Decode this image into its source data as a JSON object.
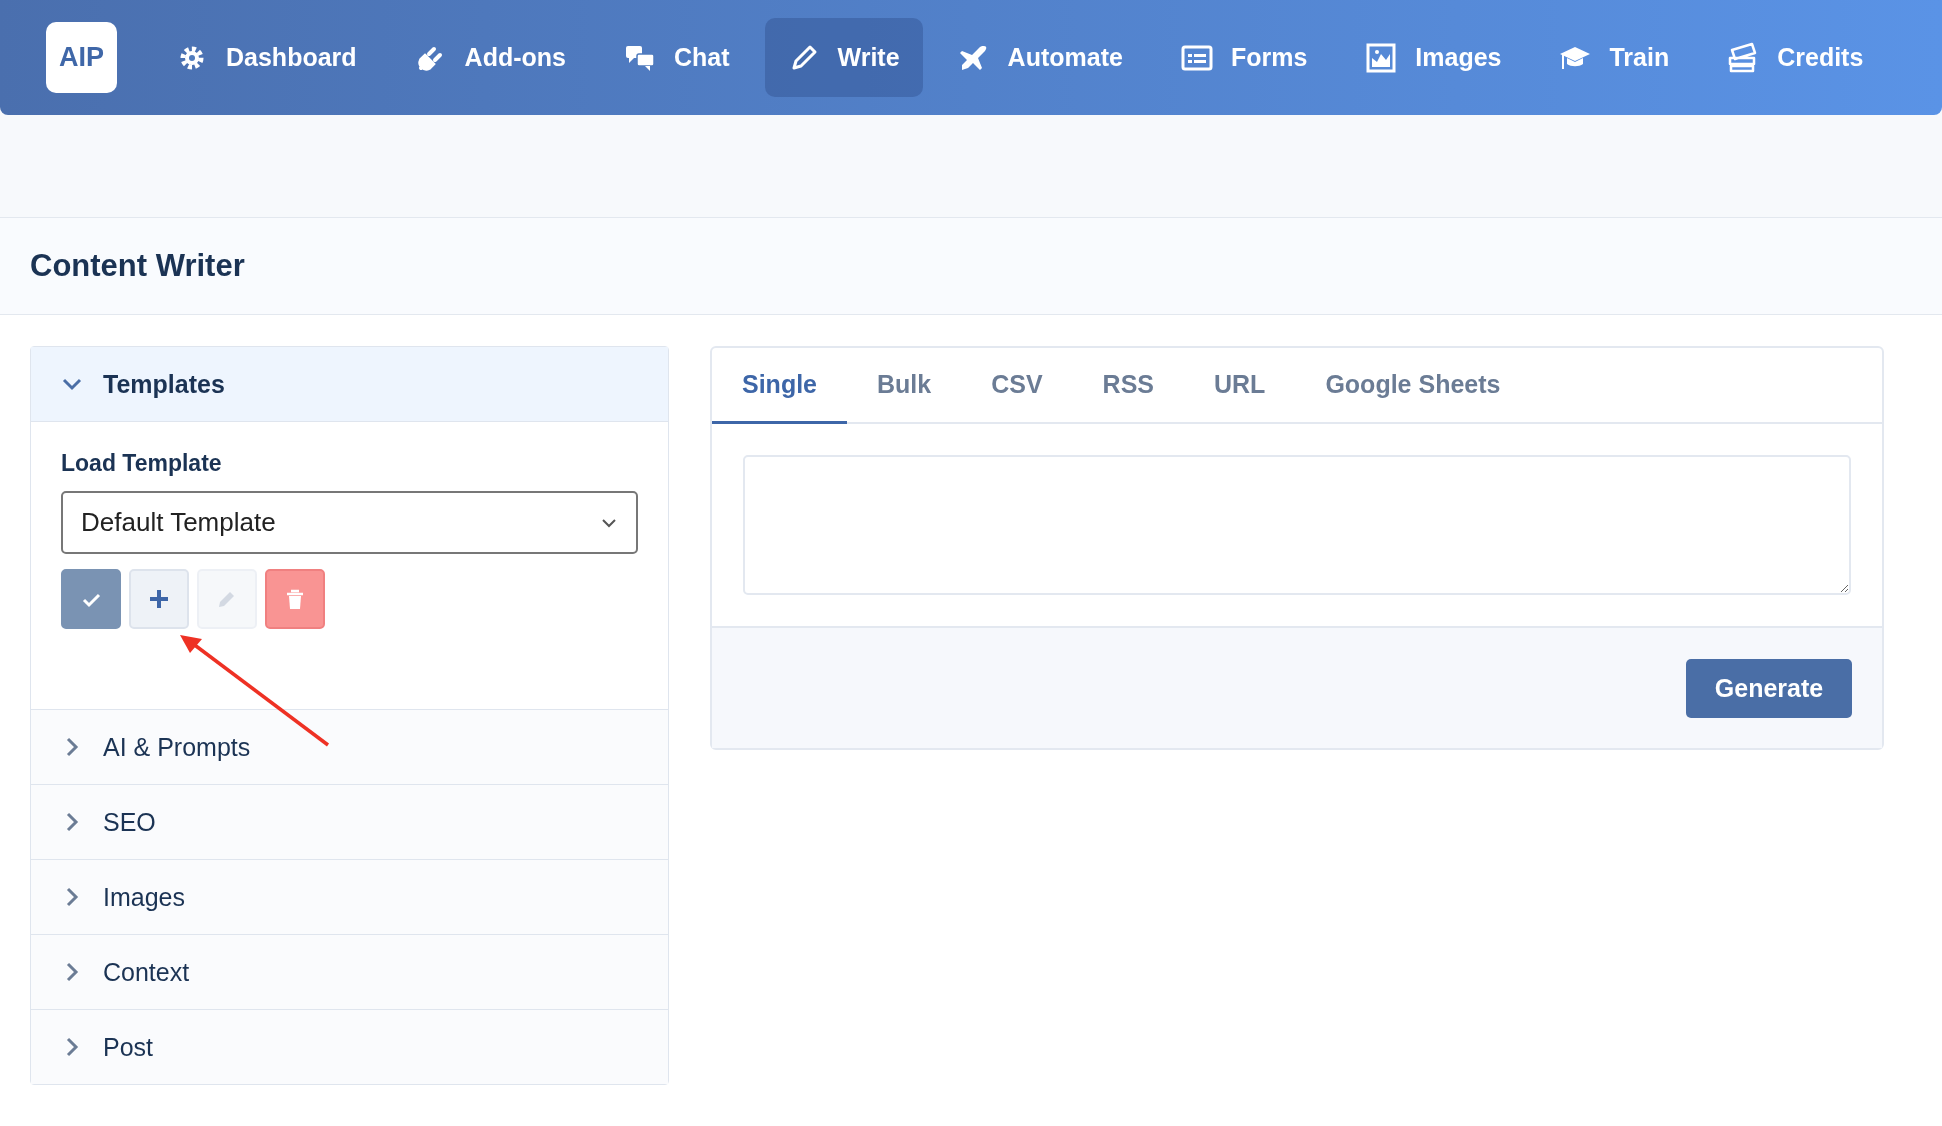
{
  "logo": "AIP",
  "nav": [
    {
      "label": "Dashboard",
      "selected": false
    },
    {
      "label": "Add-ons",
      "selected": false
    },
    {
      "label": "Chat",
      "selected": false
    },
    {
      "label": "Write",
      "selected": true
    },
    {
      "label": "Automate",
      "selected": false
    },
    {
      "label": "Forms",
      "selected": false
    },
    {
      "label": "Images",
      "selected": false
    },
    {
      "label": "Train",
      "selected": false
    },
    {
      "label": "Credits",
      "selected": false
    }
  ],
  "page_title": "Content Writer",
  "sections": [
    {
      "title": "Templates",
      "expanded": true
    },
    {
      "title": "AI & Prompts",
      "expanded": false
    },
    {
      "title": "SEO",
      "expanded": false
    },
    {
      "title": "Images",
      "expanded": false
    },
    {
      "title": "Context",
      "expanded": false
    },
    {
      "title": "Post",
      "expanded": false
    }
  ],
  "template_form": {
    "label": "Load Template",
    "value": "Default Template",
    "actions": [
      {
        "kind": "apply",
        "disabled": false
      },
      {
        "kind": "add",
        "disabled": false
      },
      {
        "kind": "edit",
        "disabled": true
      },
      {
        "kind": "delete",
        "disabled": false
      }
    ]
  },
  "tabs": [
    {
      "label": "Single",
      "selected": true
    },
    {
      "label": "Bulk",
      "selected": false
    },
    {
      "label": "CSV",
      "selected": false
    },
    {
      "label": "RSS",
      "selected": false
    },
    {
      "label": "URL",
      "selected": false
    },
    {
      "label": "Google Sheets",
      "selected": false
    }
  ],
  "generate_button": "Generate"
}
